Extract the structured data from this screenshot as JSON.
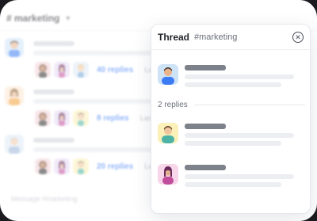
{
  "channel": {
    "name": "# marketing",
    "messages": [
      {
        "replies": "40 replies",
        "last": "Last"
      },
      {
        "replies": "8 replies",
        "last": "Last"
      },
      {
        "replies": "20 replies",
        "last": "Last"
      }
    ],
    "input_placeholder": "Message #marketing"
  },
  "thread": {
    "title": "Thread",
    "channel": "#marketing",
    "replies_count": "2 replies"
  },
  "colors": {
    "accent": "#3b7cf5",
    "avatar_blue": "#cfe3f7",
    "avatar_orange": "#fde6cf",
    "avatar_yellow": "#fbf0b8",
    "avatar_pink": "#f7d6ea"
  }
}
